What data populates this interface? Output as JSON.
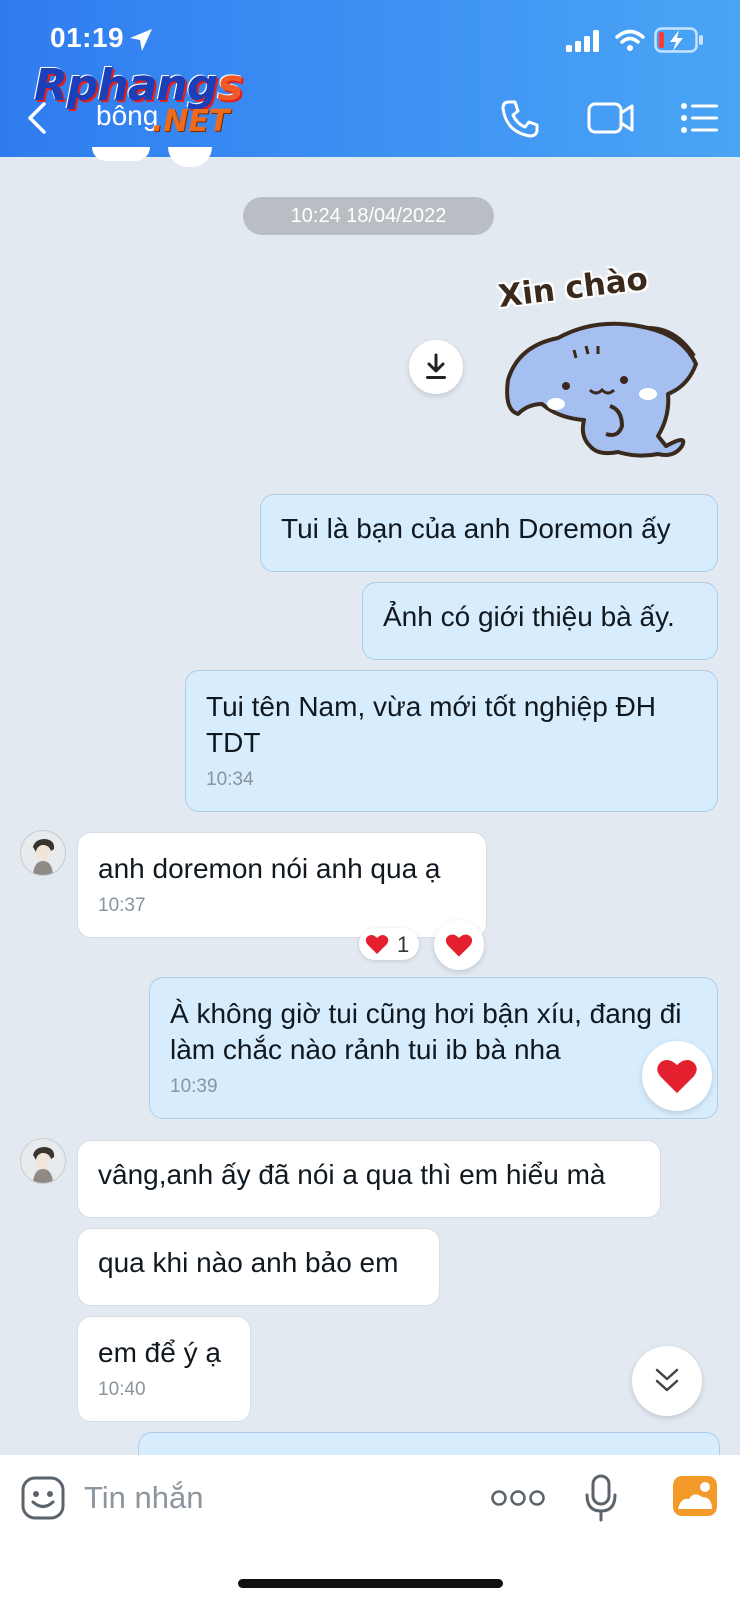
{
  "status_bar": {
    "time": "01:19"
  },
  "watermark": {
    "brand_main": "Rphang",
    "brand_s": "s",
    "brand_net": ".NET"
  },
  "header": {
    "contact_name": "bông"
  },
  "chat": {
    "date_separator": "10:24 18/04/2022",
    "sticker_caption": "Xin chào",
    "messages": [
      {
        "side": "me",
        "text": "Tui là bạn của anh Doremon ấy",
        "time": ""
      },
      {
        "side": "me",
        "text": "Ảnh có giới thiệu bà ấy.",
        "time": ""
      },
      {
        "side": "me",
        "text": "Tui tên Nam, vừa mới tốt nghiệp ĐH TDT",
        "time": "10:34"
      },
      {
        "side": "them",
        "text": "anh doremon nói anh qua ạ",
        "time": "10:37",
        "reaction_count": "1"
      },
      {
        "side": "me",
        "text": "À không giờ tui cũng hơi bận xíu, đang đi làm chắc nào rảnh tui ib bà nha",
        "time": "10:39"
      },
      {
        "side": "them",
        "text": "vâng,anh ấy đã nói a qua thì em hiểu mà",
        "time": ""
      },
      {
        "side": "them",
        "text": "qua khi nào anh bảo em",
        "time": ""
      },
      {
        "side": "them",
        "text": "em để ý ạ",
        "time": "10:40"
      }
    ]
  },
  "composer": {
    "placeholder": "Tin nhắn"
  },
  "colors": {
    "header_start": "#2f7cf0",
    "header_end": "#4aa5f5",
    "my_bubble": "#d7ecfc",
    "their_bubble": "#ffffff",
    "heart": "#e5202e",
    "background": "#e2e9f1"
  },
  "icons": [
    "location-arrow-icon",
    "signal-icon",
    "wifi-icon",
    "battery-charging-icon",
    "back-chevron-icon",
    "phone-icon",
    "video-call-icon",
    "menu-list-icon",
    "download-icon",
    "heart-icon",
    "scroll-down-icon",
    "emoji-icon",
    "more-dots-icon",
    "microphone-icon",
    "image-gallery-icon"
  ]
}
